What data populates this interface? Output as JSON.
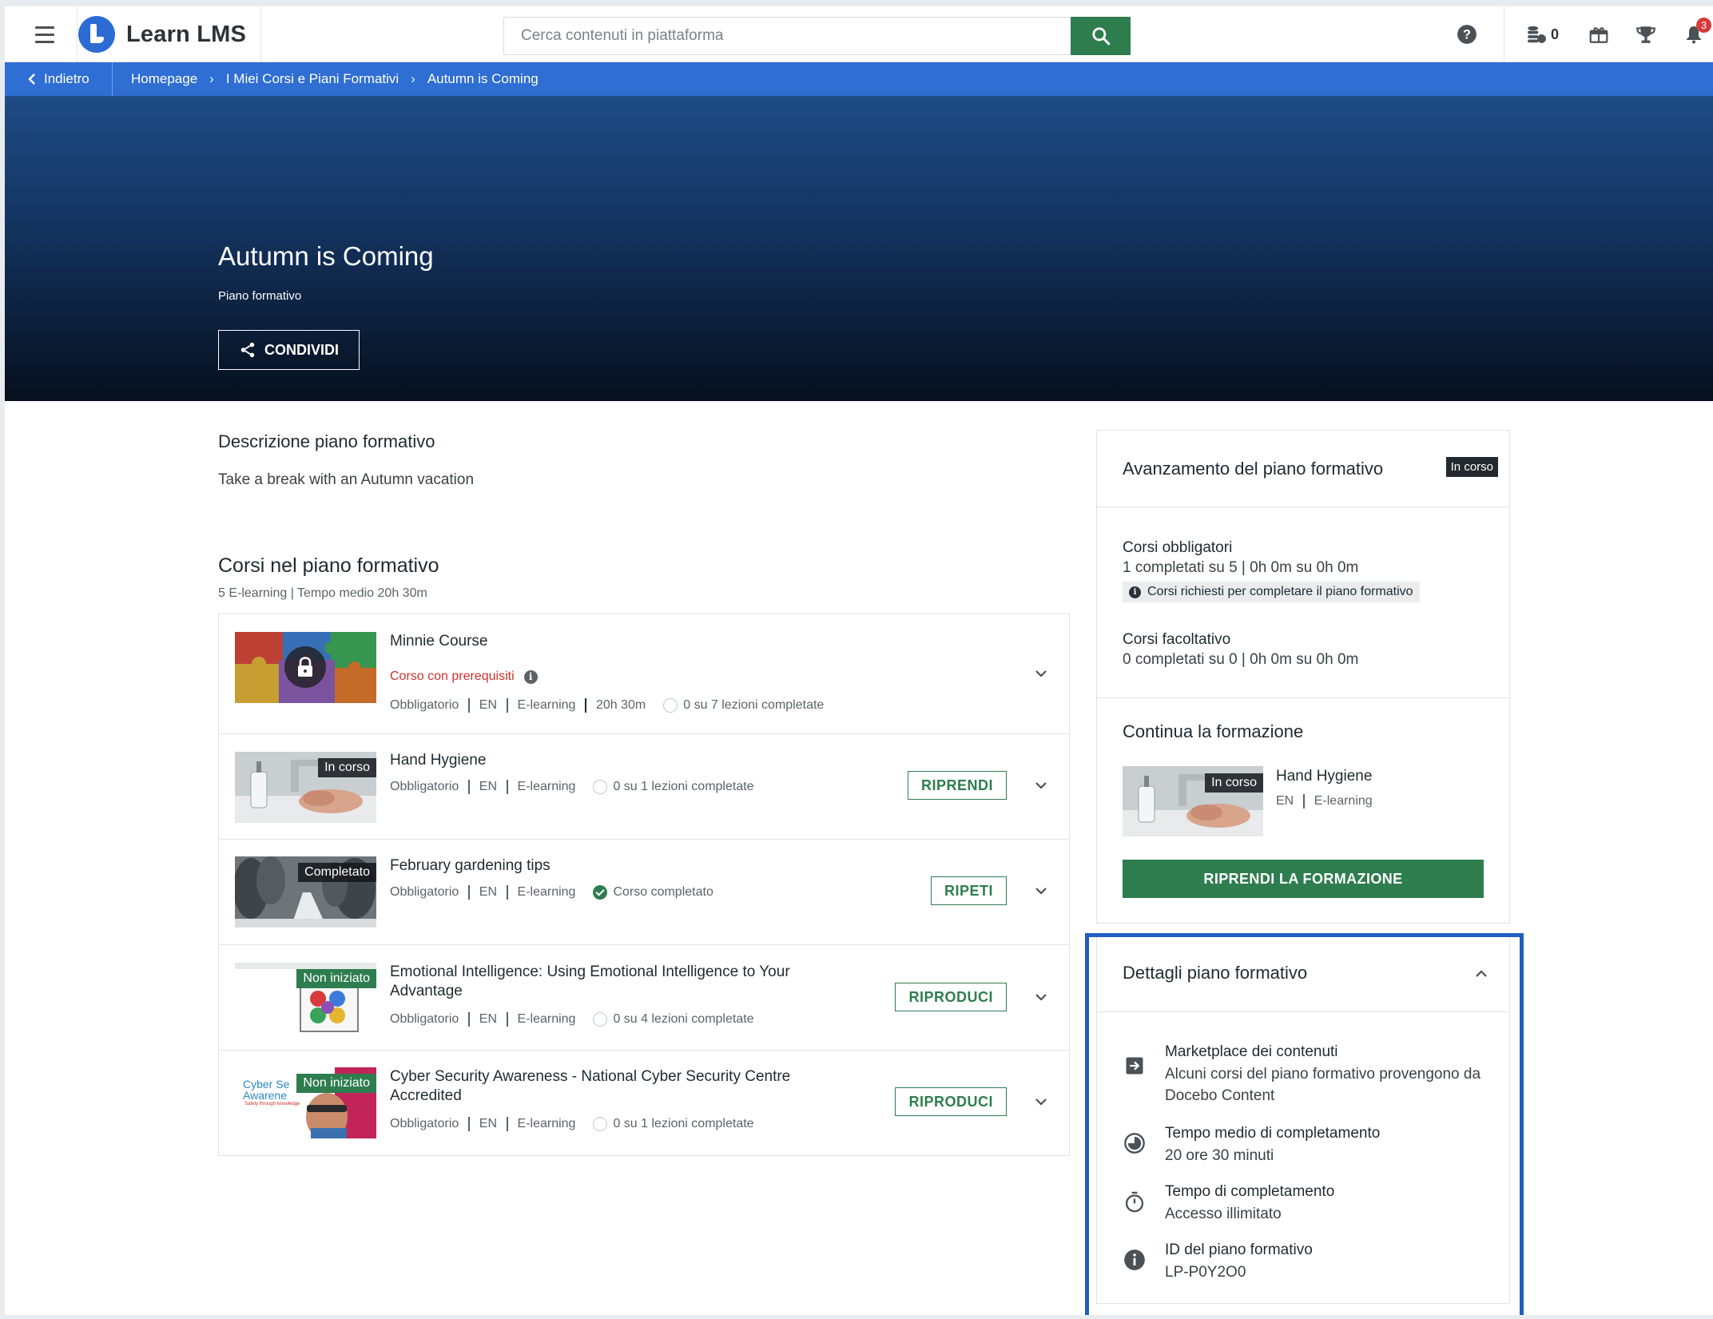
{
  "topbar": {
    "brand": "Learn LMS",
    "search_placeholder": "Cerca contenuti in piattaforma",
    "coins_count": "0",
    "notifications_count": "3"
  },
  "breadcrumb": {
    "back": "Indietro",
    "items": [
      "Homepage",
      "I Miei Corsi e Piani Formativi",
      "Autumn is Coming"
    ]
  },
  "hero": {
    "title": "Autumn is Coming",
    "subtitle": "Piano formativo",
    "share_label": "CONDIVIDI"
  },
  "description": {
    "heading": "Descrizione piano formativo",
    "text": "Take a break with an Autumn vacation"
  },
  "courses": {
    "heading": "Corsi nel piano formativo",
    "summary": "5 E-learning | Tempo medio 20h 30m",
    "items": [
      {
        "title": "Minnie Course",
        "prereq": "Corso con prerequisiti",
        "type": "Obbligatorio",
        "lang": "EN",
        "format": "E-learning",
        "duration": "20h 30m",
        "progress": "0 su 7 lezioni completate"
      },
      {
        "title": "Hand Hygiene",
        "badge": "In corso",
        "type": "Obbligatorio",
        "lang": "EN",
        "format": "E-learning",
        "progress": "0 su 1 lezioni completate",
        "action": "RIPRENDI"
      },
      {
        "title": "February gardening tips",
        "badge": "Completato",
        "type": "Obbligatorio",
        "lang": "EN",
        "format": "E-learning",
        "progress": "Corso completato",
        "action": "RIPETI"
      },
      {
        "title": "Emotional Intelligence: Using Emotional Intelligence to Your Advantage",
        "badge": "Non iniziato",
        "type": "Obbligatorio",
        "lang": "EN",
        "format": "E-learning",
        "progress": "0 su 4 lezioni completate",
        "action": "RIPRODUCI"
      },
      {
        "title": "Cyber Security Awareness - National Cyber Security Centre Accredited",
        "badge": "Non iniziato",
        "thumb_text_1": "Cyber Se",
        "thumb_text_2": "Awarene",
        "thumb_text_3": "Safety through knowledge",
        "type": "Obbligatorio",
        "lang": "EN",
        "format": "E-learning",
        "progress": "0 su 1 lezioni completate",
        "action": "RIPRODUCI"
      }
    ]
  },
  "progress_card": {
    "title": "Avanzamento del piano formativo",
    "status": "In corso",
    "mandatory_label": "Corsi obbligatori",
    "mandatory_value": "1 completati su 5 | 0h 0m su 0h 0m",
    "required_note": "Corsi richiesti per completare il piano formativo",
    "optional_label": "Corsi facoltativo",
    "optional_value": "0 completati su 0 | 0h 0m su 0h 0m",
    "continue_title": "Continua la formazione",
    "continue_course": "Hand Hygiene",
    "continue_badge": "In corso",
    "continue_lang": "EN",
    "continue_format": "E-learning",
    "resume_button": "RIPRENDI LA FORMAZIONE"
  },
  "details_card": {
    "title": "Dettagli piano formativo",
    "items": [
      {
        "label": "Marketplace dei contenuti",
        "text": "Alcuni corsi del piano formativo provengono da Docebo Content"
      },
      {
        "label": "Tempo medio di completamento",
        "text": "20 ore 30 minuti"
      },
      {
        "label": "Tempo di completamento",
        "text": "Accesso illimitato"
      },
      {
        "label": "ID del piano formativo",
        "text": "LP-P0Y2O0"
      }
    ]
  },
  "colors": {
    "brand_blue": "#2f6ed3",
    "action_green": "#2e7d4f",
    "error_red": "#d1312b",
    "highlight_border": "#1f5fbf"
  }
}
